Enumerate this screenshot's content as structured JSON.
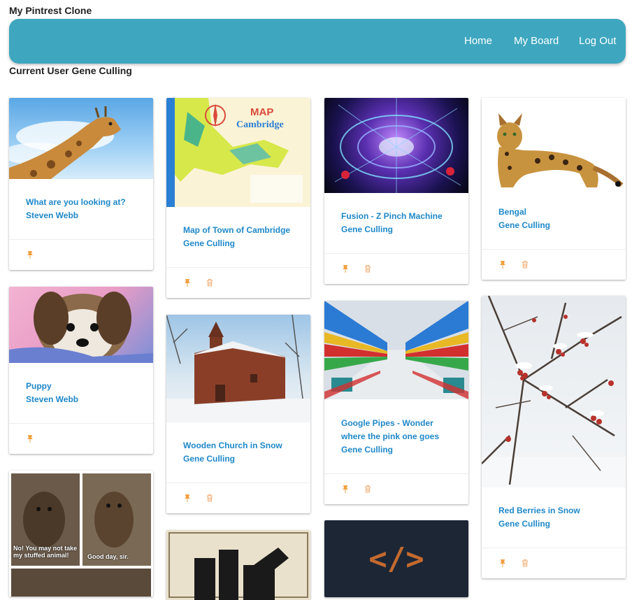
{
  "app": {
    "title": "My Pintrest Clone"
  },
  "nav": {
    "home": "Home",
    "board": "My Board",
    "logout": "Log Out"
  },
  "user": {
    "label": "Current User Gene Culling"
  },
  "pins": [
    {
      "title": "What are you looking at?",
      "author": "Steven Webb"
    },
    {
      "title": "Puppy",
      "author": "Steven Webb"
    },
    {
      "title": "Map of Town of Cambridge",
      "author": "Gene Culling",
      "map_lines": [
        "MAP",
        "Cambridge"
      ]
    },
    {
      "title": "Wooden Church in Snow",
      "author": "Gene Culling"
    },
    {
      "title": "Fusion - Z Pinch Machine",
      "author": "Gene Culling"
    },
    {
      "title": "Google Pipes - Wonder where the pink one goes",
      "author": "Gene Culling"
    },
    {
      "title": "Bengal",
      "author": "Gene Culling"
    },
    {
      "title": "Red Berries in Snow",
      "author": "Gene Culling"
    },
    {
      "meme_left": "No! You may not take my stuffed animal!",
      "meme_right": "Good day, sir."
    },
    {
      "code_glyph": "</>"
    }
  ],
  "colors": {
    "navbar": "#3ea7bf",
    "link": "#1e88c9",
    "pin": "#f0a040",
    "trash": "#f3b07a"
  }
}
